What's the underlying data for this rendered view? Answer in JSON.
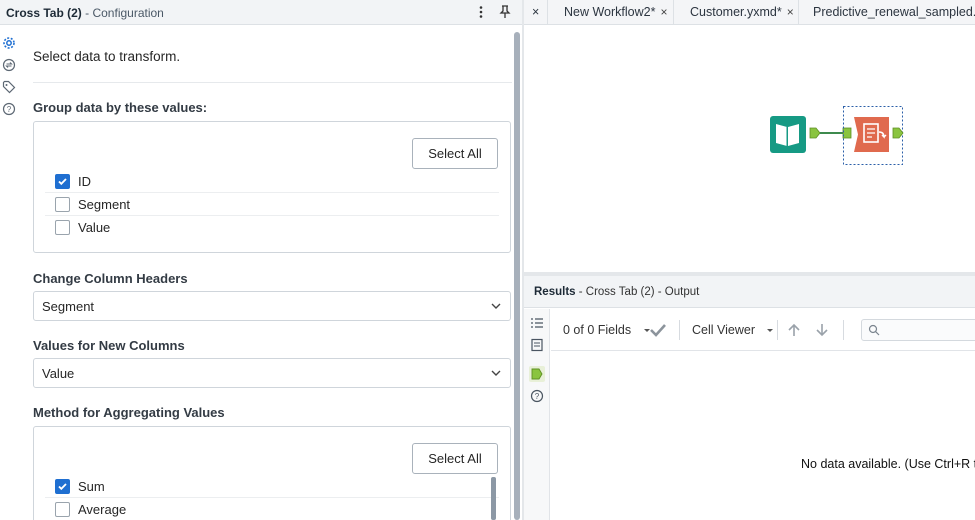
{
  "config": {
    "title": "Cross Tab (2)",
    "subtitle": "- Configuration",
    "lead_text": "Select data to transform.",
    "group_section": {
      "label": "Group data by these values:",
      "select_all_label": "Select All",
      "fields": [
        {
          "label": "ID",
          "checked": true
        },
        {
          "label": "Segment",
          "checked": false
        },
        {
          "label": "Value",
          "checked": false
        }
      ]
    },
    "headers_section": {
      "label": "Change Column Headers",
      "value": "Segment"
    },
    "values_section": {
      "label": "Values for New Columns",
      "value": "Value"
    },
    "method_section": {
      "label": "Method for Aggregating Values",
      "select_all_label": "Select All",
      "options": [
        {
          "label": "Sum",
          "checked": true
        },
        {
          "label": "Average",
          "checked": false
        }
      ]
    }
  },
  "tabs": {
    "close_label": "×",
    "items": [
      {
        "label": "New Workflow2*"
      },
      {
        "label": "Customer.yxmd*"
      },
      {
        "label": "Predictive_renewal_sampled.yxm"
      }
    ]
  },
  "canvas": {
    "tools": [
      {
        "name": "input-data-tool",
        "color": "#169a84"
      },
      {
        "name": "cross-tab-tool",
        "color": "#e06a4e"
      }
    ],
    "connector_color": "#8ac43f"
  },
  "results": {
    "title_bold": "Results",
    "title_rest": "- Cross Tab (2) - Output",
    "fields_label": "0 of 0 Fields",
    "cell_viewer_label": "Cell Viewer",
    "no_data_text": "No data available. (Use Ctrl+R to"
  },
  "colors": {
    "accent": "#1f6fd1",
    "panel_header": "#f2f4f6",
    "border": "#cfd5db"
  }
}
